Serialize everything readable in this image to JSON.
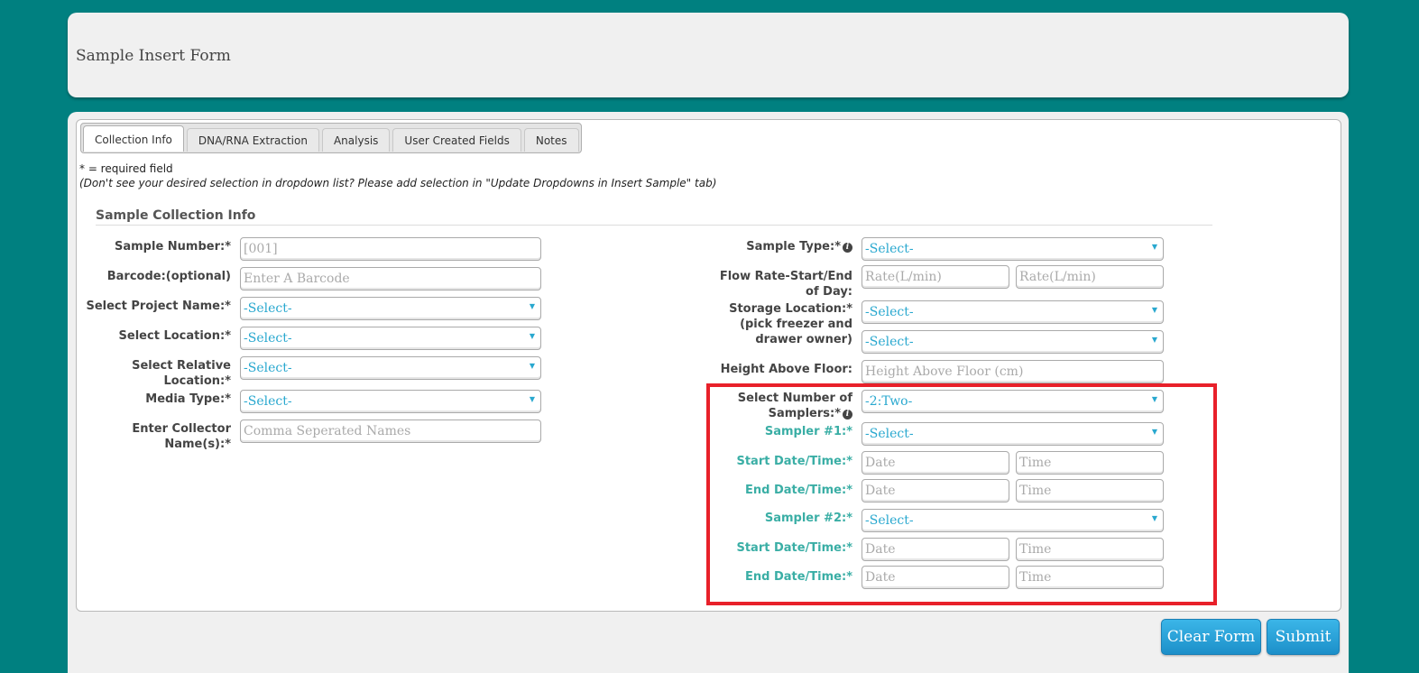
{
  "header": {
    "title": "Sample Insert Form"
  },
  "tabs": [
    {
      "label": "Collection Info"
    },
    {
      "label": "DNA/RNA Extraction"
    },
    {
      "label": "Analysis"
    },
    {
      "label": "User Created Fields"
    },
    {
      "label": "Notes"
    }
  ],
  "notes": {
    "required": "* = required field",
    "hint": "(Don't see your desired selection in dropdown list? Please add selection in \"Update Dropdowns in Insert Sample\" tab)"
  },
  "section": {
    "title": "Sample Collection Info"
  },
  "left": {
    "sample_number": {
      "label": "Sample Number:*",
      "placeholder": "[001]"
    },
    "barcode": {
      "label": "Barcode:(optional)",
      "placeholder": "Enter A Barcode"
    },
    "project": {
      "label": "Select Project Name:*",
      "value": "-Select-"
    },
    "location": {
      "label": "Select Location:*",
      "value": "-Select-"
    },
    "relative_location": {
      "label1": "Select Relative",
      "label2": "Location:*",
      "value": "-Select-"
    },
    "media_type": {
      "label": "Media Type:*",
      "value": "-Select-"
    },
    "collector": {
      "label1": "Enter Collector",
      "label2": "Name(s):*",
      "placeholder": "Comma Seperated Names"
    }
  },
  "right": {
    "sample_type": {
      "label": "Sample Type:*",
      "value": "-Select-"
    },
    "flow_rate": {
      "label1": "Flow Rate-Start/End",
      "label2": "of Day:",
      "start_placeholder": "Rate(L/min)",
      "end_placeholder": "Rate(L/min)"
    },
    "storage": {
      "label1": "Storage Location:*",
      "label2": "(pick freezer and",
      "label3": "drawer owner)",
      "freezer_value": "-Select-",
      "drawer_value": "-Select-"
    },
    "height": {
      "label": "Height Above Floor:",
      "placeholder": "Height Above Floor (cm)"
    },
    "num_samplers": {
      "label1": "Select Number of",
      "label2": "Samplers:*",
      "value": "-2:Two-"
    },
    "samplers": [
      {
        "label": "Sampler #1:*",
        "value": "-Select-",
        "start_label": "Start Date/Time:*",
        "end_label": "End Date/Time:*",
        "date_placeholder": "Date",
        "time_placeholder": "Time"
      },
      {
        "label": "Sampler #2:*",
        "value": "-Select-",
        "start_label": "Start Date/Time:*",
        "end_label": "End Date/Time:*",
        "date_placeholder": "Date",
        "time_placeholder": "Time"
      }
    ]
  },
  "buttons": {
    "clear": "Clear Form",
    "submit": "Submit"
  },
  "icons": {
    "info": "info-icon",
    "dropdown": "dropdown-arrow-icon"
  },
  "colors": {
    "background": "#008080",
    "accent": "#29a8cf",
    "highlight": "#e8202a",
    "sampler_label": "#3aaea5"
  }
}
